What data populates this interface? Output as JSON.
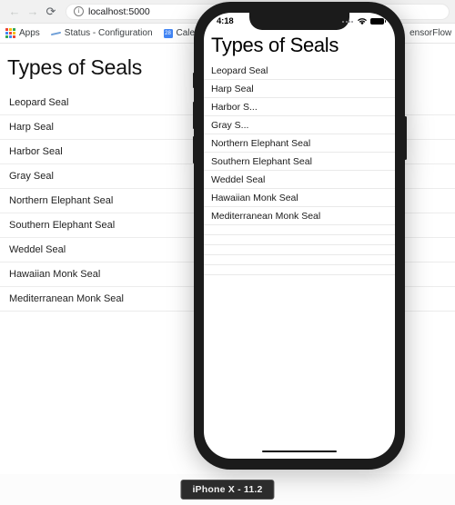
{
  "browser": {
    "nav": {
      "back_icon": "arrow-left-icon",
      "forward_icon": "arrow-right-icon",
      "reload_icon": "reload-icon",
      "back_label": "←",
      "forward_label": "→",
      "reload_label": "⟳"
    },
    "omnibox": {
      "info_label": "i",
      "url": "localhost:5000"
    },
    "bookmarks": [
      {
        "label": "Apps",
        "icon": "apps-grid-icon"
      },
      {
        "label": "Status - Configuration",
        "icon": "status-dash-icon"
      },
      {
        "label": "Calendar",
        "icon": "calendar-icon",
        "badge": "28"
      },
      {
        "label": "ensorFlow",
        "icon": "tensorflow-icon"
      }
    ]
  },
  "page": {
    "title": "Types of Seals",
    "items": [
      "Leopard Seal",
      "Harp Seal",
      "Harbor Seal",
      "Gray Seal",
      "Northern Elephant Seal",
      "Southern Elephant Seal",
      "Weddel Seal",
      "Hawaiian Monk Seal",
      "Mediterranean Monk Seal"
    ]
  },
  "phone": {
    "statusbar": {
      "time": "4:18",
      "signal_icon": "signal-dots-icon",
      "wifi_icon": "wifi-icon",
      "battery_icon": "battery-icon"
    },
    "app": {
      "title": "Types of Seals",
      "items": [
        "Leopard Seal",
        "Harp Seal",
        "Harbor S...",
        "Gray S...",
        "Northern Elephant Seal",
        "Southern Elephant Seal",
        "Weddel Seal",
        "Hawaiian Monk Seal",
        "Mediterranean Monk Seal"
      ],
      "empty_rows": 5
    },
    "buttons": {
      "silent": "silent-switch",
      "volume_up": "volume-up-button",
      "volume_down": "volume-down-button",
      "power": "power-button"
    },
    "home_indicator": "home-indicator"
  },
  "device_label": "iPhone X - 11.2",
  "colors": {
    "toolbar_bg": "#f1f1f1",
    "phone_frame": "#1b1b1b",
    "accent_blue": "#4285f4",
    "separator": "#ececec",
    "label_bg": "#2c2c2c"
  }
}
